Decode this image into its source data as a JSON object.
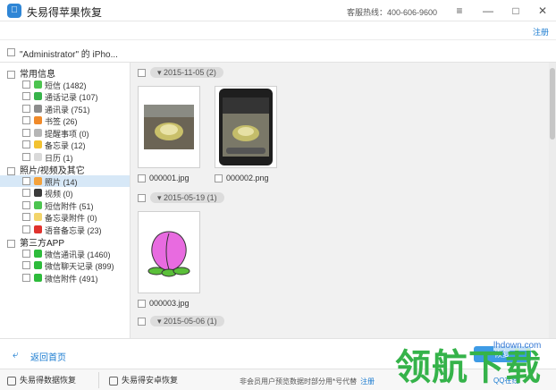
{
  "window": {
    "title": "失易得苹果恢复",
    "hotline": "客服热线：400-606-9600",
    "register_link": "注册"
  },
  "device": {
    "name": "\"Administrator\" 的 iPho..."
  },
  "sidebar": {
    "groups": [
      {
        "label": "常用信息",
        "items": [
          {
            "label": "短信 (1482)",
            "icon_color": "#4cc44f",
            "icon": "sms-icon"
          },
          {
            "label": "通话记录 (107)",
            "icon_color": "#36b34a",
            "icon": "phone-icon"
          },
          {
            "label": "通讯录 (751)",
            "icon_color": "#8d8d8d",
            "icon": "contacts-icon"
          },
          {
            "label": "书签 (26)",
            "icon_color": "#f08a2a",
            "icon": "bookmark-icon"
          },
          {
            "label": "提醒事项 (0)",
            "icon_color": "#b5b5b5",
            "icon": "reminder-icon"
          },
          {
            "label": "备忘录 (12)",
            "icon_color": "#f2c230",
            "icon": "notes-icon"
          },
          {
            "label": "日历 (1)",
            "icon_color": "#d9d9d9",
            "icon": "calendar-icon"
          }
        ]
      },
      {
        "label": "照片/视频及其它",
        "items": [
          {
            "label": "照片 (14)",
            "icon_color": "#f4a23c",
            "icon": "photos-icon",
            "selected": true
          },
          {
            "label": "视频 (0)",
            "icon_color": "#3a3a3a",
            "icon": "video-icon"
          },
          {
            "label": "短信附件 (51)",
            "icon_color": "#4cc44f",
            "icon": "sms-attachment-icon"
          },
          {
            "label": "备忘录附件 (0)",
            "icon_color": "#f2d46a",
            "icon": "notes-attachment-icon"
          },
          {
            "label": "语音备忘录 (23)",
            "icon_color": "#e0322d",
            "icon": "voice-memo-icon"
          }
        ]
      },
      {
        "label": "第三方APP",
        "items": [
          {
            "label": "微信通讯录 (1460)",
            "icon_color": "#2dbb3b",
            "icon": "wechat-icon"
          },
          {
            "label": "微信聊天记录 (899)",
            "icon_color": "#2dbb3b",
            "icon": "wechat-icon"
          },
          {
            "label": "微信附件 (491)",
            "icon_color": "#2dbb3b",
            "icon": "wechat-icon"
          }
        ]
      }
    ]
  },
  "content": {
    "sections": [
      {
        "date": "2015-11-05 (2)",
        "files": [
          "000001.jpg",
          "000002.png"
        ]
      },
      {
        "date": "2015-05-19 (1)",
        "files": [
          "000003.jpg"
        ]
      },
      {
        "date": "2015-05-06 (1)",
        "files": []
      }
    ]
  },
  "footer": {
    "back_label": "返回首页",
    "recover_label": "恢复",
    "data_recovery": "失易得数据恢复",
    "android_recovery": "失易得安卓恢复",
    "notice": "非会员用户预览数据时部分用*号代替",
    "notice_link": "注册",
    "qq_label": "QQ在线"
  },
  "watermark": {
    "big": "领航下载",
    "small": "lhdown.com"
  }
}
